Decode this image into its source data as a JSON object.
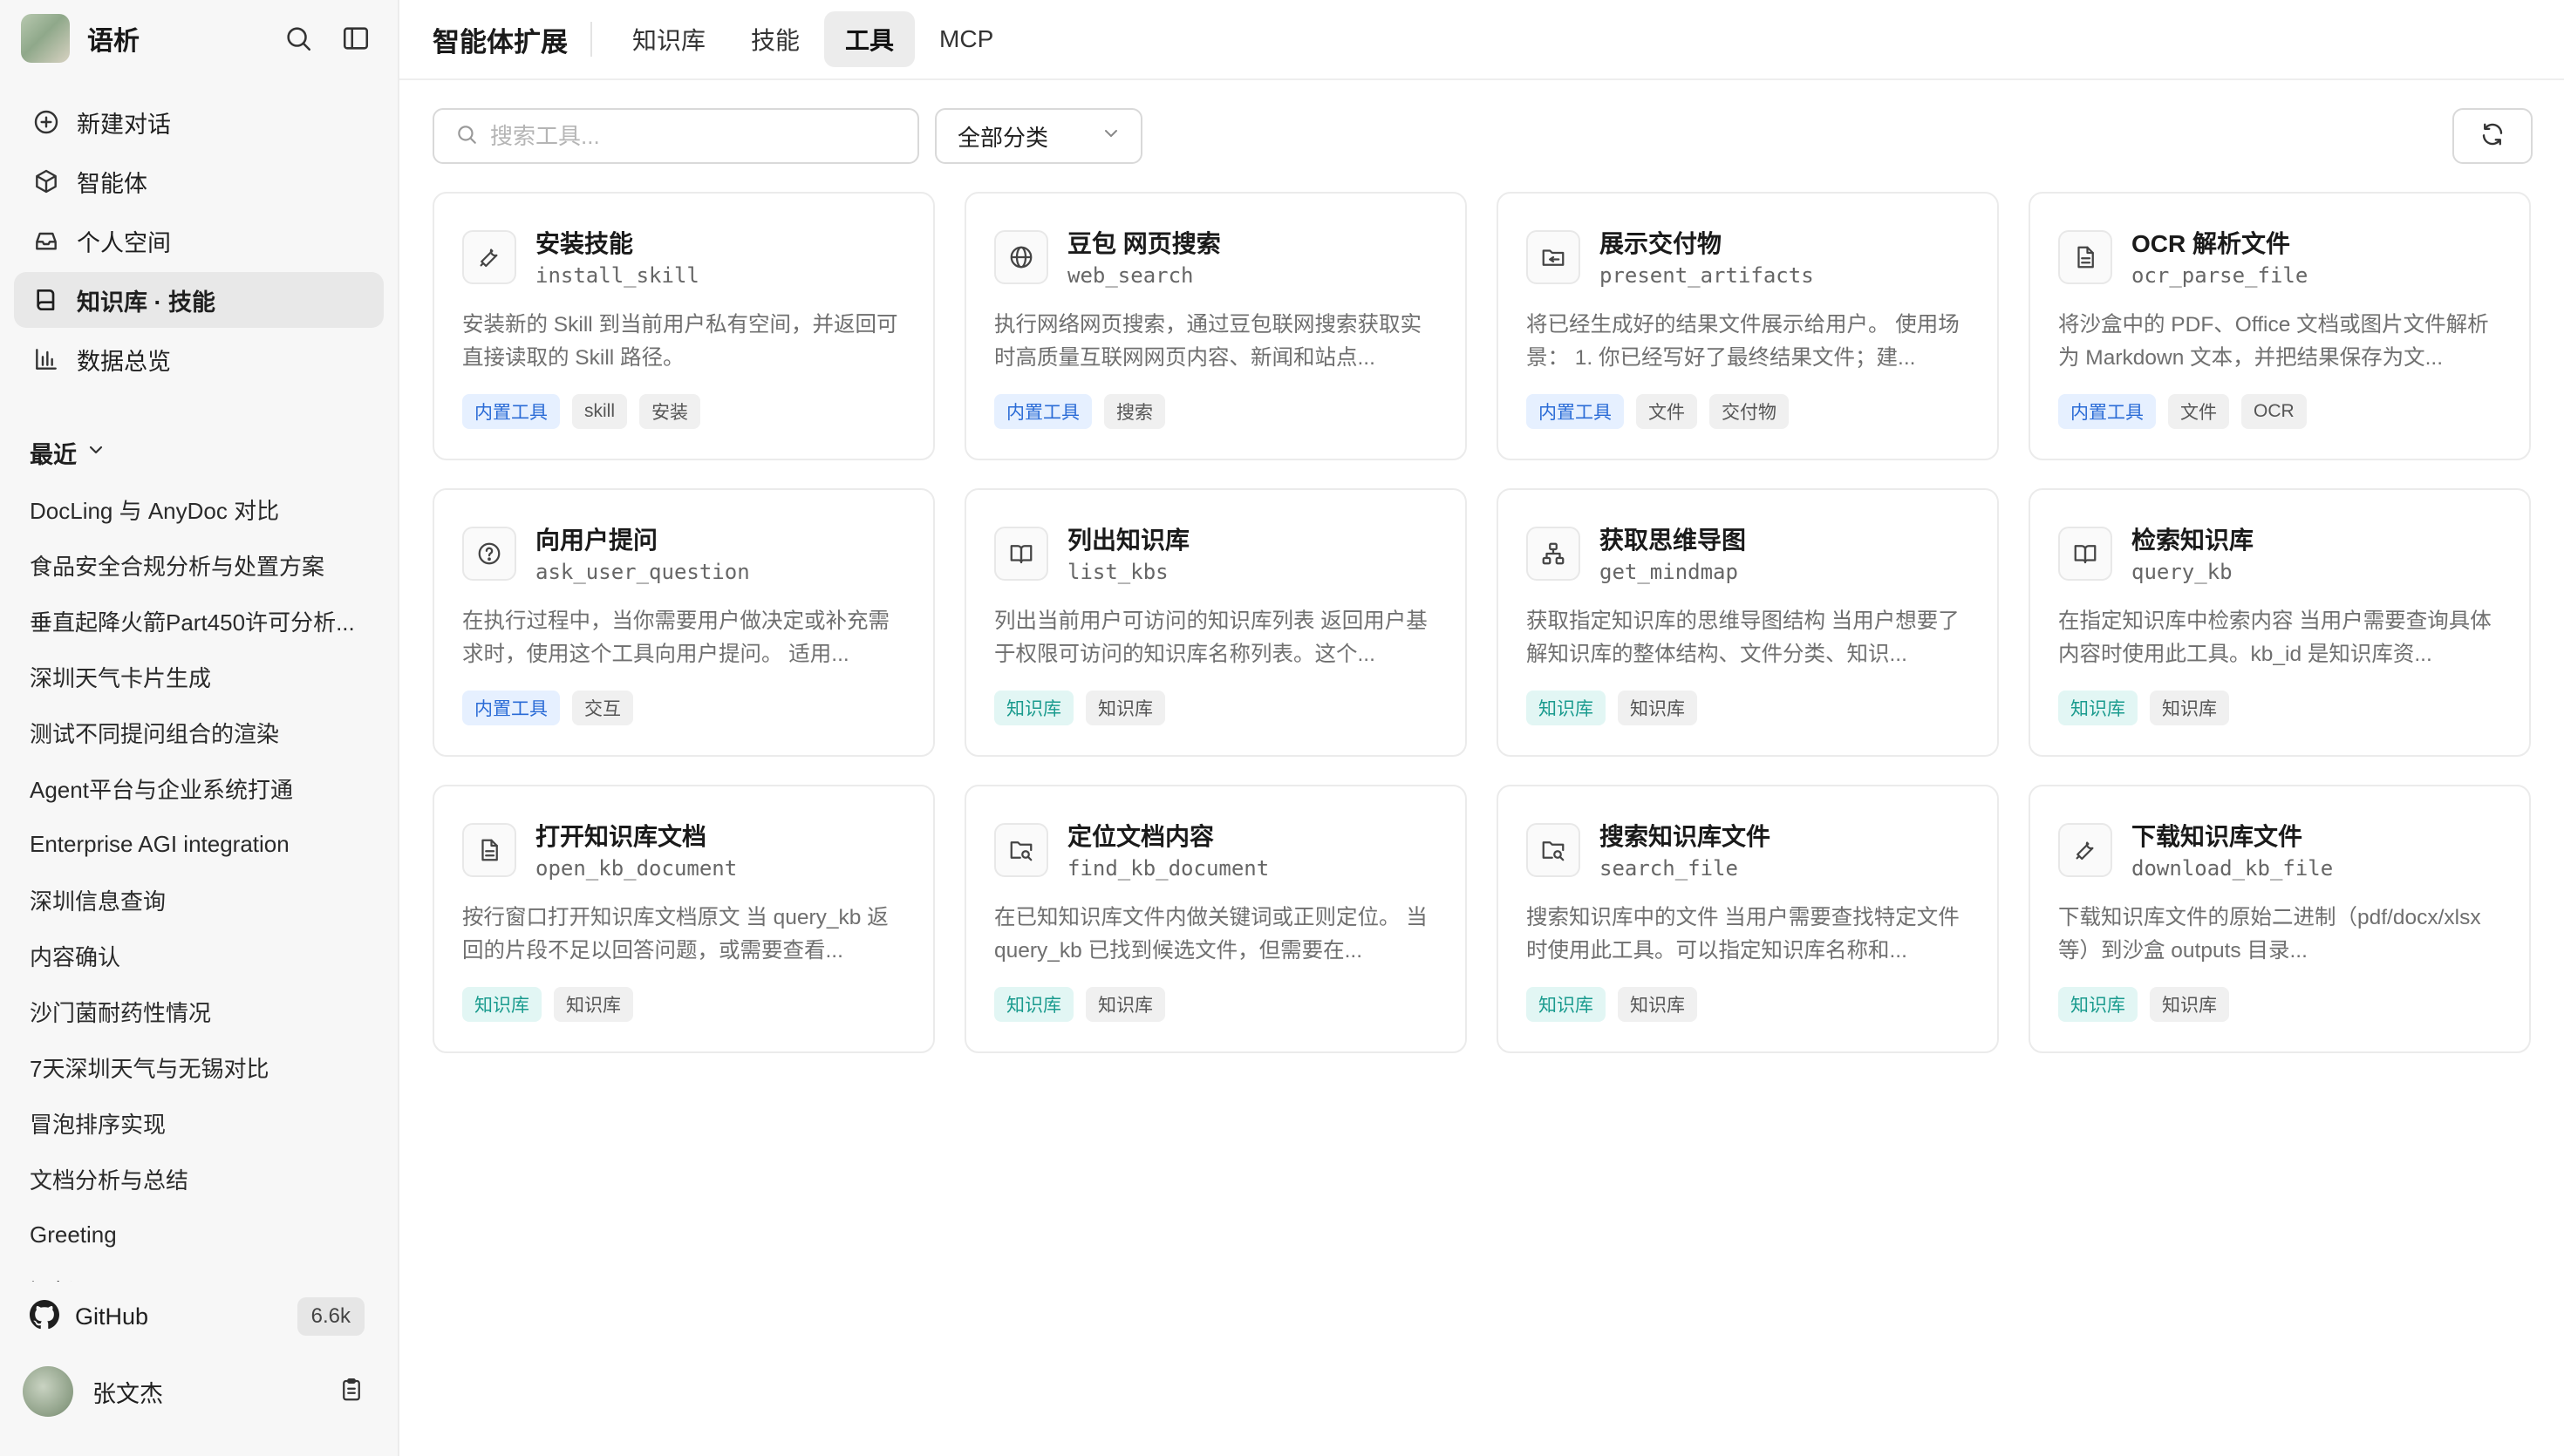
{
  "app": {
    "name": "语析"
  },
  "sidebar": {
    "nav": [
      {
        "label": "新建对话",
        "icon": "plus-circle-icon"
      },
      {
        "label": "智能体",
        "icon": "cube-icon"
      },
      {
        "label": "个人空间",
        "icon": "inbox-icon"
      },
      {
        "label": "知识库 · 技能",
        "icon": "book-icon",
        "active": true
      },
      {
        "label": "数据总览",
        "icon": "bar-chart-icon"
      }
    ],
    "recent_title": "最近",
    "recent": [
      "DocLing 与 AnyDoc 对比",
      "食品安全合规分析与处置方案",
      "垂直起降火箭Part450许可分析...",
      "深圳天气卡片生成",
      "测试不同提问组合的渲染",
      "Agent平台与企业系统打通",
      "Enterprise AGI integration",
      "深圳信息查询",
      "内容确认",
      "沙门菌耐药性情况",
      "7天深圳天气与无锡对比",
      "冒泡排序实现",
      "文档分析与总结",
      "Greeting",
      "问候"
    ],
    "github": {
      "label": "GitHub",
      "count": "6.6k"
    },
    "user": {
      "name": "张文杰"
    }
  },
  "header": {
    "title": "智能体扩展",
    "tabs": [
      {
        "label": "知识库"
      },
      {
        "label": "技能"
      },
      {
        "label": "工具",
        "active": true
      },
      {
        "label": "MCP"
      }
    ]
  },
  "toolbar": {
    "search_placeholder": "搜索工具...",
    "category": "全部分类"
  },
  "tools": [
    {
      "title": "安装技能",
      "name": "install_skill",
      "icon": "wrench-icon",
      "desc": "安装新的 Skill 到当前用户私有空间，并返回可直接读取的 Skill 路径。",
      "tags": [
        {
          "text": "内置工具",
          "color": "blue"
        },
        {
          "text": "skill"
        },
        {
          "text": "安装"
        }
      ]
    },
    {
      "title": "豆包 网页搜索",
      "name": "web_search",
      "icon": "globe-icon",
      "desc": "执行网络网页搜索，通过豆包联网搜索获取实时高质量互联网网页内容、新闻和站点...",
      "tags": [
        {
          "text": "内置工具",
          "color": "blue"
        },
        {
          "text": "搜索"
        }
      ]
    },
    {
      "title": "展示交付物",
      "name": "present_artifacts",
      "icon": "folder-share-icon",
      "desc": "将已经生成好的结果文件展示给用户。 使用场景： 1. 你已经写好了最终结果文件；建...",
      "tags": [
        {
          "text": "内置工具",
          "color": "blue"
        },
        {
          "text": "文件"
        },
        {
          "text": "交付物"
        }
      ]
    },
    {
      "title": "OCR 解析文件",
      "name": "ocr_parse_file",
      "icon": "file-text-icon",
      "desc": "将沙盒中的 PDF、Office 文档或图片文件解析为 Markdown 文本，并把结果保存为文...",
      "tags": [
        {
          "text": "内置工具",
          "color": "blue"
        },
        {
          "text": "文件"
        },
        {
          "text": "OCR"
        }
      ]
    },
    {
      "title": "向用户提问",
      "name": "ask_user_question",
      "icon": "question-circle-icon",
      "desc": "在执行过程中，当你需要用户做决定或补充需求时，使用这个工具向用户提问。 适用...",
      "tags": [
        {
          "text": "内置工具",
          "color": "blue"
        },
        {
          "text": "交互"
        }
      ]
    },
    {
      "title": "列出知识库",
      "name": "list_kbs",
      "icon": "book-open-icon",
      "desc": "列出当前用户可访问的知识库列表 返回用户基于权限可访问的知识库名称列表。这个...",
      "tags": [
        {
          "text": "知识库",
          "color": "teal"
        },
        {
          "text": "知识库"
        }
      ]
    },
    {
      "title": "获取思维导图",
      "name": "get_mindmap",
      "icon": "sitemap-icon",
      "desc": "获取指定知识库的思维导图结构 当用户想要了解知识库的整体结构、文件分类、知识...",
      "tags": [
        {
          "text": "知识库",
          "color": "teal"
        },
        {
          "text": "知识库"
        }
      ]
    },
    {
      "title": "检索知识库",
      "name": "query_kb",
      "icon": "book-open-icon",
      "desc": "在指定知识库中检索内容 当用户需要查询具体内容时使用此工具。kb_id 是知识库资...",
      "tags": [
        {
          "text": "知识库",
          "color": "teal"
        },
        {
          "text": "知识库"
        }
      ]
    },
    {
      "title": "打开知识库文档",
      "name": "open_kb_document",
      "icon": "file-text-icon",
      "desc": "按行窗口打开知识库文档原文 当 query_kb 返回的片段不足以回答问题，或需要查看...",
      "tags": [
        {
          "text": "知识库",
          "color": "teal"
        },
        {
          "text": "知识库"
        }
      ]
    },
    {
      "title": "定位文档内容",
      "name": "find_kb_document",
      "icon": "folder-search-icon",
      "desc": "在已知知识库文件内做关键词或正则定位。 当 query_kb 已找到候选文件，但需要在...",
      "tags": [
        {
          "text": "知识库",
          "color": "teal"
        },
        {
          "text": "知识库"
        }
      ]
    },
    {
      "title": "搜索知识库文件",
      "name": "search_file",
      "icon": "folder-search-icon",
      "desc": "搜索知识库中的文件 当用户需要查找特定文件时使用此工具。可以指定知识库名称和...",
      "tags": [
        {
          "text": "知识库",
          "color": "teal"
        },
        {
          "text": "知识库"
        }
      ]
    },
    {
      "title": "下载知识库文件",
      "name": "download_kb_file",
      "icon": "wrench-icon",
      "desc": "下载知识库文件的原始二进制（pdf/docx/xlsx 等）到沙盒 outputs 目录...",
      "tags": [
        {
          "text": "知识库",
          "color": "teal"
        },
        {
          "text": "知识库"
        }
      ]
    }
  ]
}
